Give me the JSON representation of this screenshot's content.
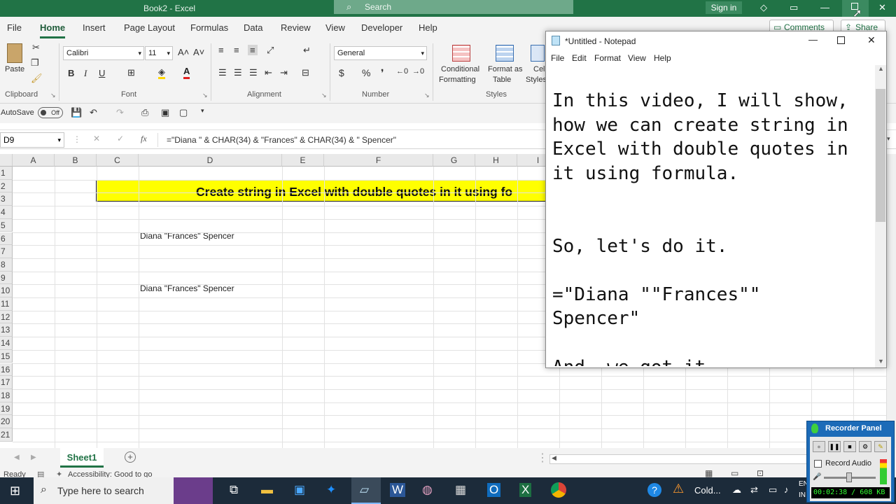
{
  "excel": {
    "title": "Book2  -  Excel",
    "search_placeholder": "Search",
    "signin": "Sign in",
    "tabs": [
      "File",
      "Home",
      "Insert",
      "Page Layout",
      "Formulas",
      "Data",
      "Review",
      "View",
      "Developer",
      "Help"
    ],
    "comments_label": "Comments",
    "share_label": "Share",
    "ribbon": {
      "paste_label": "Paste",
      "clipboard_label": "Clipboard",
      "font_name": "Calibri",
      "font_size": "11",
      "font_label": "Font",
      "bold": "B",
      "italic": "I",
      "underline": "U",
      "alignment_label": "Alignment",
      "number_format": "General",
      "number_label": "Number",
      "currency_symbol": "$",
      "percent_symbol": "%",
      "conditional_formatting_line1": "Conditional",
      "conditional_formatting_line2": "Formatting",
      "format_as_table_line1": "Format as",
      "format_as_table_line2": "Table",
      "cell_styles_line1": "Cell",
      "cell_styles_line2": "Styles",
      "styles_label": "Styles"
    },
    "qat": {
      "autosave_label": "AutoSave",
      "autosave_state": "Off"
    },
    "formula_bar": {
      "namebox": "D9",
      "fx": "fx",
      "formula": "=\"Diana \" & CHAR(34) & \"Frances\" & CHAR(34) & \" Spencer\""
    },
    "columns": [
      "A",
      "B",
      "C",
      "D",
      "E",
      "F",
      "G",
      "H",
      "I"
    ],
    "rows": [
      "1",
      "2",
      "3",
      "4",
      "5",
      "6",
      "7",
      "8",
      "9",
      "10",
      "11",
      "12",
      "13",
      "14",
      "15",
      "16",
      "17",
      "18",
      "19",
      "20",
      "21"
    ],
    "banner_text": "Create string in Excel with double quotes in it using fo",
    "cells": {
      "D5": "Diana \"Frances\" Spencer",
      "D9": "Diana \"Frances\" Spencer"
    },
    "sheet_tab": "Sheet1",
    "status": {
      "ready": "Ready",
      "accessibility": "Accessibility: Good to go"
    },
    "colors": {
      "accent": "#217346",
      "banner_fill": "#ffff00"
    }
  },
  "notepad": {
    "title": "*Untitled - Notepad",
    "menu": [
      "File",
      "Edit",
      "Format",
      "View",
      "Help"
    ],
    "text": "In this video, I will show,\nhow we can create string in\nExcel with double quotes in\nit using formula.\n\n\nSo, let's do it.\n\n=\"Diana \"\"Frances\"\"\nSpencer\"\n\nAnd, we got it."
  },
  "taskbar": {
    "search_placeholder": "Type here to search",
    "weather": "Cold...",
    "lang_line1": "EN",
    "lang_line2": "IN"
  },
  "recorder": {
    "title": "Recorder Panel",
    "record_audio": "Record Audio",
    "status": "00:02:38 / 608 KB"
  }
}
